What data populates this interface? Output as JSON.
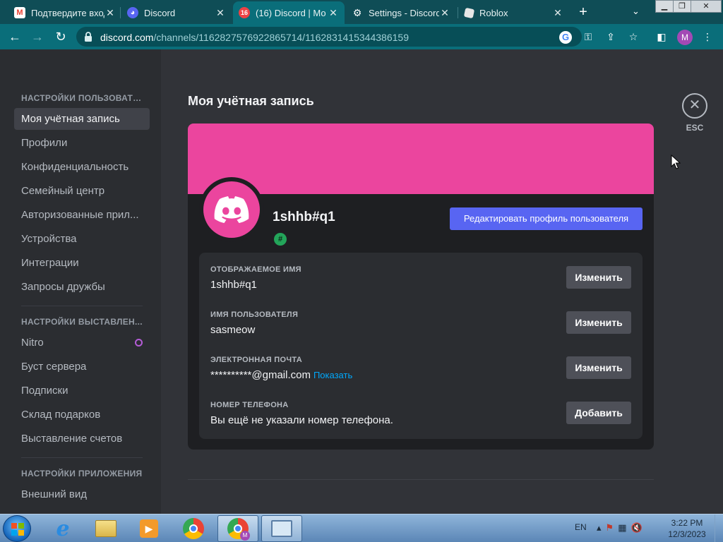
{
  "browser": {
    "tabs": [
      {
        "title": "Подтвердите вход",
        "icon": "gmail-icon",
        "active": false
      },
      {
        "title": "Discord",
        "icon": "discord-icon",
        "active": false
      },
      {
        "title": "(16) Discord | Мо",
        "icon": "discord-badge-icon",
        "active": true,
        "badge": "16"
      },
      {
        "title": "Settings - Discord",
        "icon": "gear-icon",
        "active": false
      },
      {
        "title": "Roblox",
        "icon": "roblox-icon",
        "active": false
      }
    ],
    "url_host": "discord.com",
    "url_path": "/channels/1162827576922865714/1162831415344386159",
    "profile_initial": "M"
  },
  "sidebar": {
    "section_user": "НАСТРОЙКИ ПОЛЬЗОВАТЕ...",
    "user_items": [
      "Моя учётная запись",
      "Профили",
      "Конфиденциальность",
      "Семейный центр",
      "Авторизованные прил...",
      "Устройства",
      "Интеграции",
      "Запросы дружбы"
    ],
    "section_billing": "НАСТРОЙКИ ВЫСТАВЛЕН...",
    "billing_items": [
      "Nitro",
      "Буст сервера",
      "Подписки",
      "Склад подарков",
      "Выставление счетов"
    ],
    "section_app": "НАСТРОЙКИ ПРИЛОЖЕНИЯ",
    "app_items": [
      "Внешний вид"
    ]
  },
  "main": {
    "title": "Моя учётная запись",
    "esc_label": "ESC",
    "banner_color": "#eb459e",
    "username": "1shhb#q1",
    "badge_symbol": "#",
    "edit_profile_label": "Редактировать профиль пользователя",
    "fields": [
      {
        "label": "ОТОБРАЖАЕМОЕ ИМЯ",
        "value": "1shhb#q1",
        "button": "Изменить"
      },
      {
        "label": "ИМЯ ПОЛЬЗОВАТЕЛЯ",
        "value": "sasmeow",
        "button": "Изменить"
      },
      {
        "label": "ЭЛЕКТРОННАЯ ПОЧТА",
        "value": "**********@gmail.com",
        "link": "Показать",
        "button": "Изменить"
      },
      {
        "label": "НОМЕР ТЕЛЕФОНА",
        "value": "Вы ещё не указали номер телефона.",
        "button": "Добавить"
      }
    ]
  },
  "taskbar": {
    "lang": "EN",
    "time": "3:22 PM",
    "date": "12/3/2023"
  },
  "colors": {
    "accent": "#5865f2",
    "browser_frame": "#0a6e7a",
    "link": "#00a8fc"
  }
}
